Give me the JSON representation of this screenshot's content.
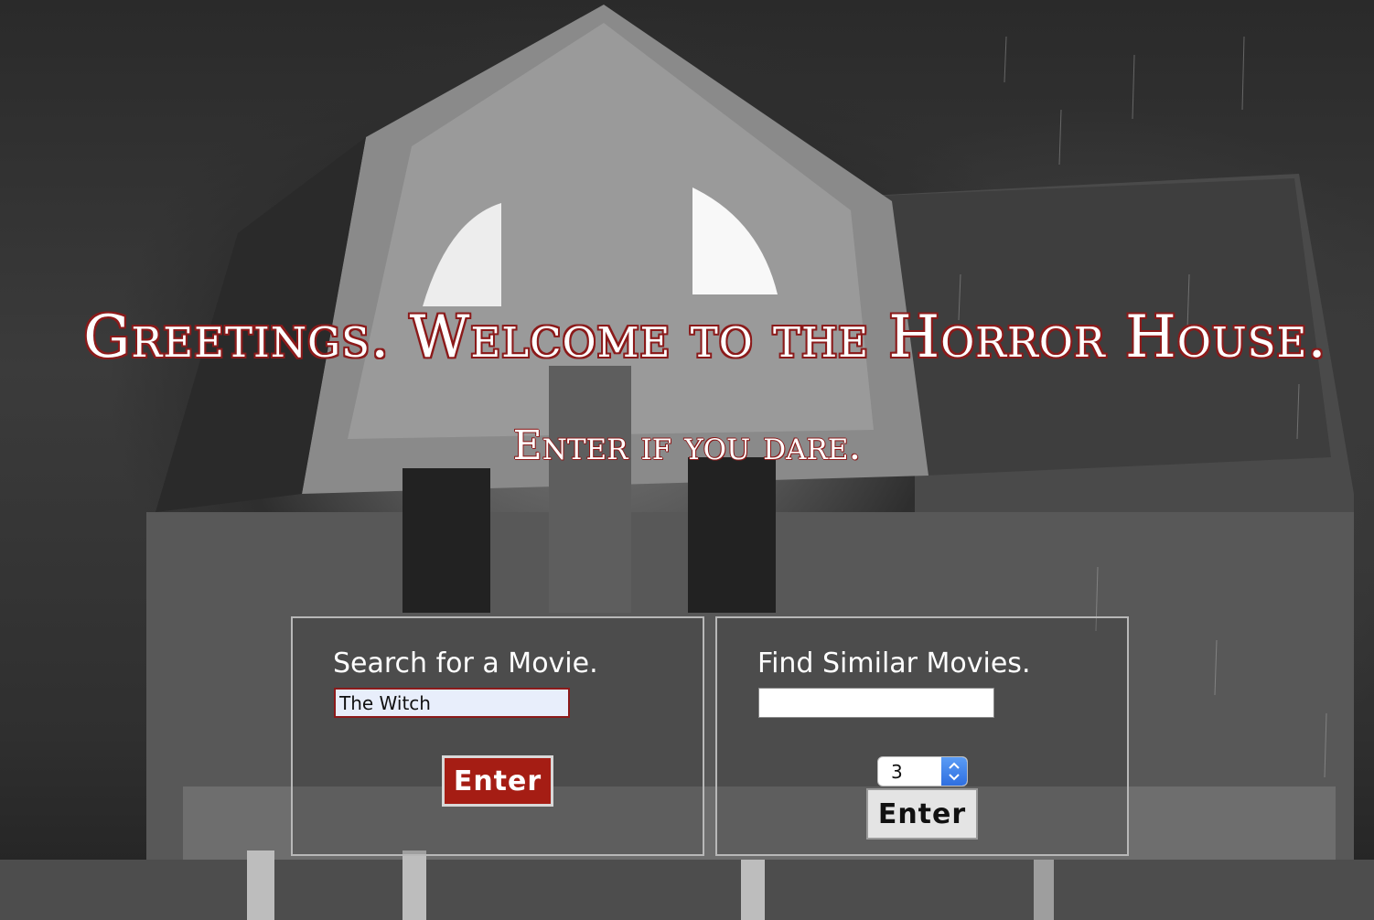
{
  "header": {
    "title": "Greetings. Welcome to the Horror House.",
    "subtitle": "Enter if you dare."
  },
  "search_panel": {
    "heading": "Search for a Movie.",
    "input_value": "The Witch",
    "button_label": "Enter"
  },
  "similar_panel": {
    "heading": "Find Similar Movies.",
    "input_value": "",
    "count_selected": "3",
    "button_label": "Enter"
  },
  "colors": {
    "title_outline": "#8b1a1a",
    "enter_button_bg": "#a51d14",
    "select_accent": "#2f6fe0"
  }
}
